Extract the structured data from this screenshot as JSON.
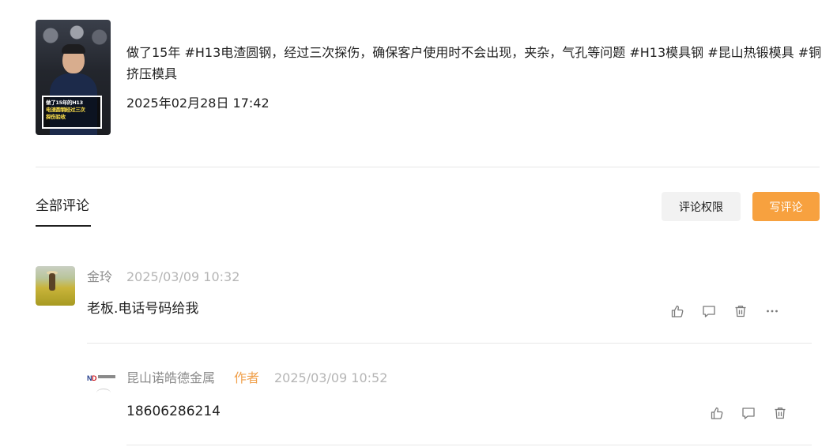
{
  "video": {
    "thumbnail_caption": [
      "做了15年的H13",
      "电渣圆钢经过三次",
      "探伤验收"
    ],
    "description": "做了15年 #H13电渣圆钢，经过三次探伤，确保客户使用时不会出现，夹杂，气孔等问题 #H13模具钢 #昆山热锻模具 #铜挤压模具",
    "date": "2025年02月28日 17:42"
  },
  "comments_header": {
    "tab_all_label": "全部评论",
    "permission_button_label": "评论权限",
    "write_button_label": "写评论"
  },
  "comments": [
    {
      "author": "金玲",
      "time": "2025/03/09 10:32",
      "text": "老板.电话号码给我",
      "actions": [
        "like-icon",
        "reply-icon",
        "delete-icon",
        "more-icon"
      ],
      "replies": [
        {
          "author": "昆山诺皓德金属",
          "badge": "作者",
          "time": "2025/03/09 10:52",
          "text": "18606286214",
          "avatar_logo_text": "ND诺皓德金属",
          "actions": [
            "like-icon",
            "reply-icon",
            "delete-icon"
          ]
        }
      ]
    }
  ],
  "colors": {
    "accent": "#f7a13f",
    "author_badge": "#f0a04b",
    "muted_text": "#8c8c8c",
    "timestamp": "#b5b5b5",
    "divider": "#e6e6e6"
  }
}
